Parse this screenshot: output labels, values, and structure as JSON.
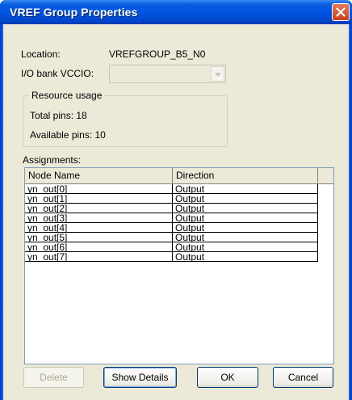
{
  "window": {
    "title": "VREF Group Properties"
  },
  "location": {
    "label": "Location:",
    "value": "VREFGROUP_B5_N0"
  },
  "vccio": {
    "label": "I/O bank VCCIO:",
    "value": ""
  },
  "resource_usage": {
    "title": "Resource usage",
    "total_pins": "Total pins: 18",
    "available_pins": "Available pins: 10"
  },
  "assignments": {
    "label": "Assignments:",
    "columns": [
      "Node Name",
      "Direction"
    ],
    "rows": [
      [
        "yn_out[0]",
        "Output"
      ],
      [
        "yn_out[1]",
        "Output"
      ],
      [
        "yn_out[2]",
        "Output"
      ],
      [
        "yn_out[3]",
        "Output"
      ],
      [
        "yn_out[4]",
        "Output"
      ],
      [
        "yn_out[5]",
        "Output"
      ],
      [
        "yn_out[6]",
        "Output"
      ],
      [
        "yn_out[7]",
        "Output"
      ]
    ]
  },
  "buttons": {
    "delete": "Delete",
    "show_details": "Show Details",
    "ok": "OK",
    "cancel": "Cancel"
  }
}
